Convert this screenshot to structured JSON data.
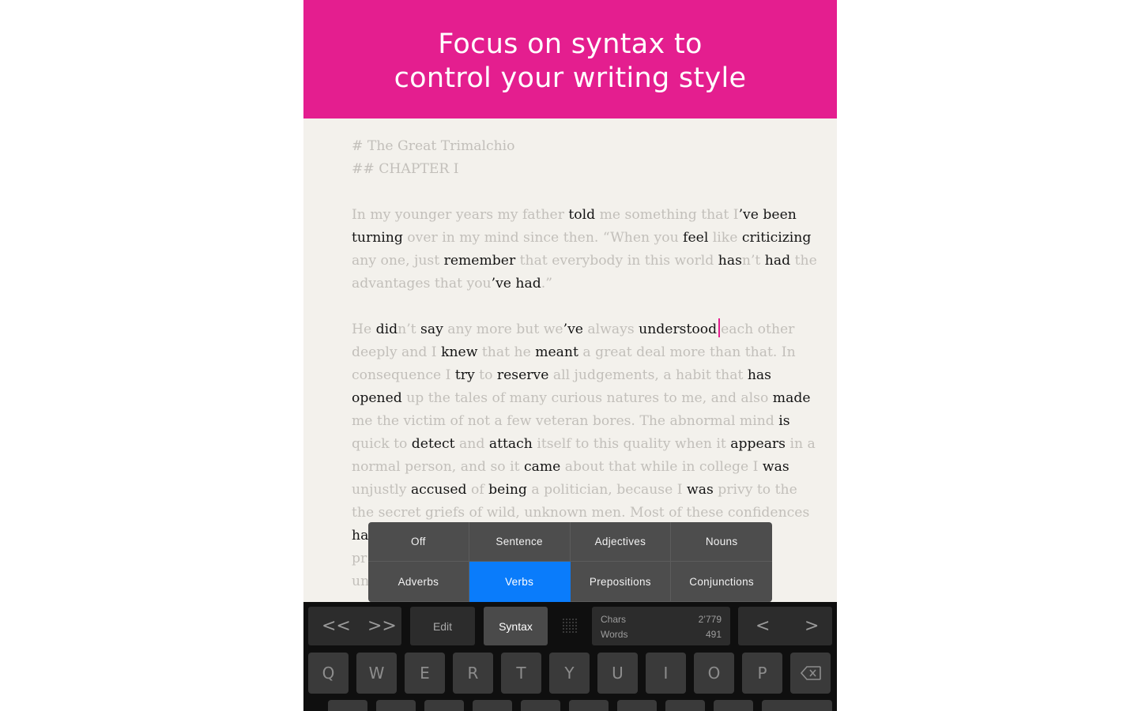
{
  "banner": {
    "line1": "Focus on syntax to",
    "line2": "control your writing style"
  },
  "editor": {
    "heading1": "# The Great Trimalchio",
    "heading2": "## CHAPTER I",
    "lines": [
      [
        [
          "In my younger years my father ",
          0
        ],
        [
          "told",
          1
        ],
        [
          " me something that I",
          0
        ],
        [
          "’ve been",
          1
        ]
      ],
      [
        [
          "turning",
          1
        ],
        [
          " over in my mind since then. “When you ",
          0
        ],
        [
          "feel",
          1
        ],
        [
          " like ",
          0
        ],
        [
          "criticizing",
          1
        ]
      ],
      [
        [
          "any one, just ",
          0
        ],
        [
          "remember",
          1
        ],
        [
          " that everybody in this world ",
          0
        ],
        [
          "has",
          1
        ],
        [
          "n’t ",
          0
        ],
        [
          "had",
          1
        ],
        [
          " the",
          0
        ]
      ],
      [
        [
          "advantages that you",
          0
        ],
        [
          "’ve had",
          1
        ],
        [
          ".”",
          0
        ]
      ],
      [],
      [
        [
          "He ",
          0
        ],
        [
          "did",
          1
        ],
        [
          "n’t ",
          0
        ],
        [
          "say",
          1
        ],
        [
          " any more but we",
          0
        ],
        [
          "’ve",
          1
        ],
        [
          " always ",
          0
        ],
        [
          "understood",
          1
        ],
        [
          "|",
          2
        ],
        [
          "each other",
          0
        ]
      ],
      [
        [
          "deeply and I ",
          0
        ],
        [
          "knew",
          1
        ],
        [
          " that he ",
          0
        ],
        [
          "meant",
          1
        ],
        [
          " a great deal more than that. In",
          0
        ]
      ],
      [
        [
          "consequence I ",
          0
        ],
        [
          "try",
          1
        ],
        [
          " to ",
          0
        ],
        [
          "reserve",
          1
        ],
        [
          " all judgements, a habit that ",
          0
        ],
        [
          "has",
          1
        ]
      ],
      [
        [
          "opened",
          1
        ],
        [
          " up the tales of many curious natures to me, and also ",
          0
        ],
        [
          "made",
          1
        ]
      ],
      [
        [
          "me the victim of not a few veteran bores. The abnormal mind ",
          0
        ],
        [
          "is",
          1
        ]
      ],
      [
        [
          "quick to ",
          0
        ],
        [
          "detect",
          1
        ],
        [
          " and ",
          0
        ],
        [
          "attach",
          1
        ],
        [
          " itself to this quality when it ",
          0
        ],
        [
          "appears",
          1
        ],
        [
          " in a",
          0
        ]
      ],
      [
        [
          "normal person, and so it ",
          0
        ],
        [
          "came",
          1
        ],
        [
          " about that while in college I ",
          0
        ],
        [
          "was",
          1
        ]
      ],
      [
        [
          "unjustly ",
          0
        ],
        [
          "accused",
          1
        ],
        [
          " of ",
          0
        ],
        [
          "being",
          1
        ],
        [
          " a politician, because I ",
          0
        ],
        [
          "was",
          1
        ],
        [
          " privy to the",
          0
        ]
      ],
      [
        [
          "the secret griefs of wild, unknown men. Most of these confidences",
          0
        ]
      ],
      [
        [
          "ha",
          1
        ]
      ],
      [
        [
          "pr",
          0
        ]
      ],
      [
        [
          "un",
          0
        ]
      ]
    ]
  },
  "syntax_menu": {
    "options": [
      "Off",
      "Sentence",
      "Adjectives",
      "Nouns",
      "Adverbs",
      "Verbs",
      "Prepositions",
      "Conjunctions"
    ],
    "selected": "Verbs"
  },
  "toolbar": {
    "back_label": "<<",
    "forward_label": ">>",
    "edit_label": "Edit",
    "syntax_label": "Syntax",
    "chars_label": "Chars",
    "chars_value": "2’779",
    "words_label": "Words",
    "words_value": "491",
    "prev_label": "<",
    "next_label": ">"
  },
  "keyboard": {
    "row1": [
      "Q",
      "W",
      "E",
      "R",
      "T",
      "Y",
      "U",
      "I",
      "O",
      "P"
    ]
  },
  "colors": {
    "accent": "#e41e8f",
    "selected": "#0a7cfb",
    "paper": "#f3f1ec"
  }
}
